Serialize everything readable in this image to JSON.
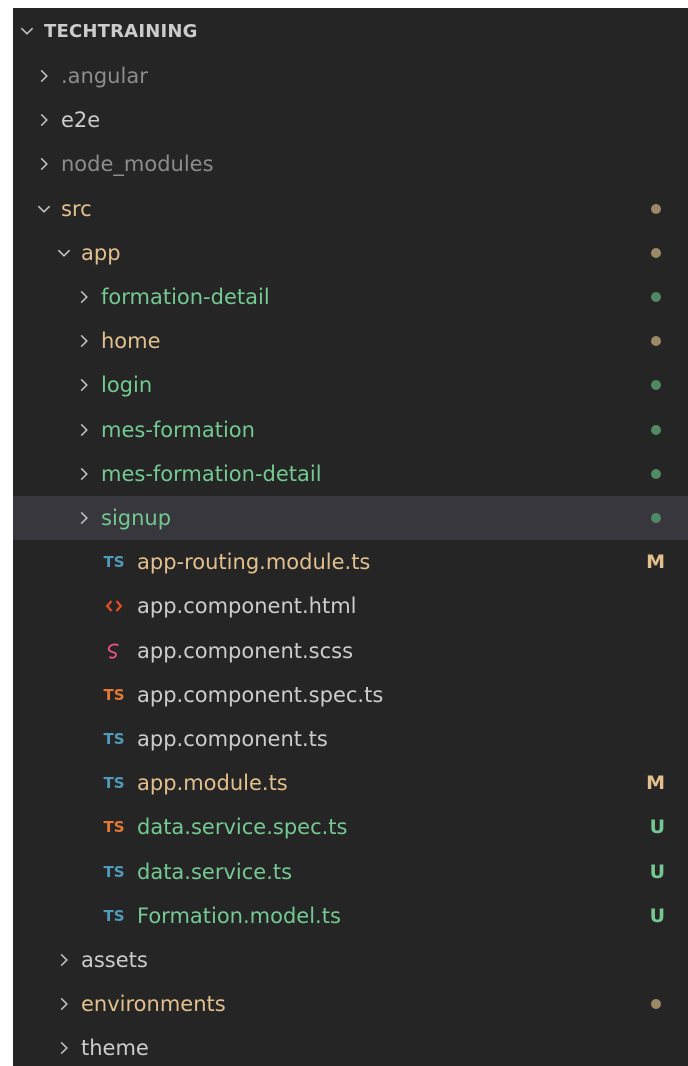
{
  "colors": {
    "panel_bg": "#252526",
    "selected_bg": "#37373d",
    "chevron": "#c5c5c5",
    "default_text": "#cccccc",
    "ignored_text": "#8c8c8c",
    "modified_text": "#e2c08d",
    "untracked_text": "#73c991",
    "modified_dot": "#9c8a67",
    "untracked_dot": "#4f8a64",
    "ts_icon": "#519aba",
    "ts_spec_icon": "#e37933",
    "html_icon": "#e44d26",
    "scss_icon": "#f55385",
    "badge_m": "#e2c08d",
    "badge_u": "#73c991"
  },
  "explorer": {
    "root": {
      "label": "TECHTRAINING",
      "expanded": true
    },
    "items": [
      {
        "label": ".angular",
        "kind": "folder",
        "expanded": false,
        "depth": 1,
        "status": "ignored"
      },
      {
        "label": "e2e",
        "kind": "folder",
        "expanded": false,
        "depth": 1,
        "status": "default"
      },
      {
        "label": "node_modules",
        "kind": "folder",
        "expanded": false,
        "depth": 1,
        "status": "ignored"
      },
      {
        "label": "src",
        "kind": "folder",
        "expanded": true,
        "depth": 1,
        "status": "modified",
        "decoration": "dot"
      },
      {
        "label": "app",
        "kind": "folder",
        "expanded": true,
        "depth": 2,
        "status": "modified",
        "decoration": "dot"
      },
      {
        "label": "formation-detail",
        "kind": "folder",
        "expanded": false,
        "depth": 3,
        "status": "untracked",
        "decoration": "dot"
      },
      {
        "label": "home",
        "kind": "folder",
        "expanded": false,
        "depth": 3,
        "status": "modified",
        "decoration": "dot"
      },
      {
        "label": "login",
        "kind": "folder",
        "expanded": false,
        "depth": 3,
        "status": "untracked",
        "decoration": "dot"
      },
      {
        "label": "mes-formation",
        "kind": "folder",
        "expanded": false,
        "depth": 3,
        "status": "untracked",
        "decoration": "dot"
      },
      {
        "label": "mes-formation-detail",
        "kind": "folder",
        "expanded": false,
        "depth": 3,
        "status": "untracked",
        "decoration": "dot"
      },
      {
        "label": "signup",
        "kind": "folder",
        "expanded": false,
        "depth": 3,
        "status": "untracked",
        "decoration": "dot",
        "selected": true
      },
      {
        "label": "app-routing.module.ts",
        "kind": "file",
        "icon": "ts-file-icon",
        "icon_text": "TS",
        "icon_color": "#519aba",
        "depth": 3,
        "status": "modified",
        "decoration": "badge",
        "badge": "M"
      },
      {
        "label": "app.component.html",
        "kind": "file",
        "icon": "html-file-icon",
        "icon_color": "#e44d26",
        "depth": 3,
        "status": "default"
      },
      {
        "label": "app.component.scss",
        "kind": "file",
        "icon": "scss-file-icon",
        "icon_color": "#f55385",
        "depth": 3,
        "status": "default"
      },
      {
        "label": "app.component.spec.ts",
        "kind": "file",
        "icon": "ts-spec-file-icon",
        "icon_text": "TS",
        "icon_color": "#e37933",
        "depth": 3,
        "status": "default"
      },
      {
        "label": "app.component.ts",
        "kind": "file",
        "icon": "ts-file-icon",
        "icon_text": "TS",
        "icon_color": "#519aba",
        "depth": 3,
        "status": "default"
      },
      {
        "label": "app.module.ts",
        "kind": "file",
        "icon": "ts-file-icon",
        "icon_text": "TS",
        "icon_color": "#519aba",
        "depth": 3,
        "status": "modified",
        "decoration": "badge",
        "badge": "M"
      },
      {
        "label": "data.service.spec.ts",
        "kind": "file",
        "icon": "ts-spec-file-icon",
        "icon_text": "TS",
        "icon_color": "#e37933",
        "depth": 3,
        "status": "untracked",
        "decoration": "badge",
        "badge": "U"
      },
      {
        "label": "data.service.ts",
        "kind": "file",
        "icon": "ts-file-icon",
        "icon_text": "TS",
        "icon_color": "#519aba",
        "depth": 3,
        "status": "untracked",
        "decoration": "badge",
        "badge": "U"
      },
      {
        "label": "Formation.model.ts",
        "kind": "file",
        "icon": "ts-file-icon",
        "icon_text": "TS",
        "icon_color": "#519aba",
        "depth": 3,
        "status": "untracked",
        "decoration": "badge",
        "badge": "U"
      },
      {
        "label": "assets",
        "kind": "folder",
        "expanded": false,
        "depth": 2,
        "status": "default"
      },
      {
        "label": "environments",
        "kind": "folder",
        "expanded": false,
        "depth": 2,
        "status": "modified",
        "decoration": "dot"
      },
      {
        "label": "theme",
        "kind": "folder",
        "expanded": false,
        "depth": 2,
        "status": "default"
      }
    ]
  }
}
